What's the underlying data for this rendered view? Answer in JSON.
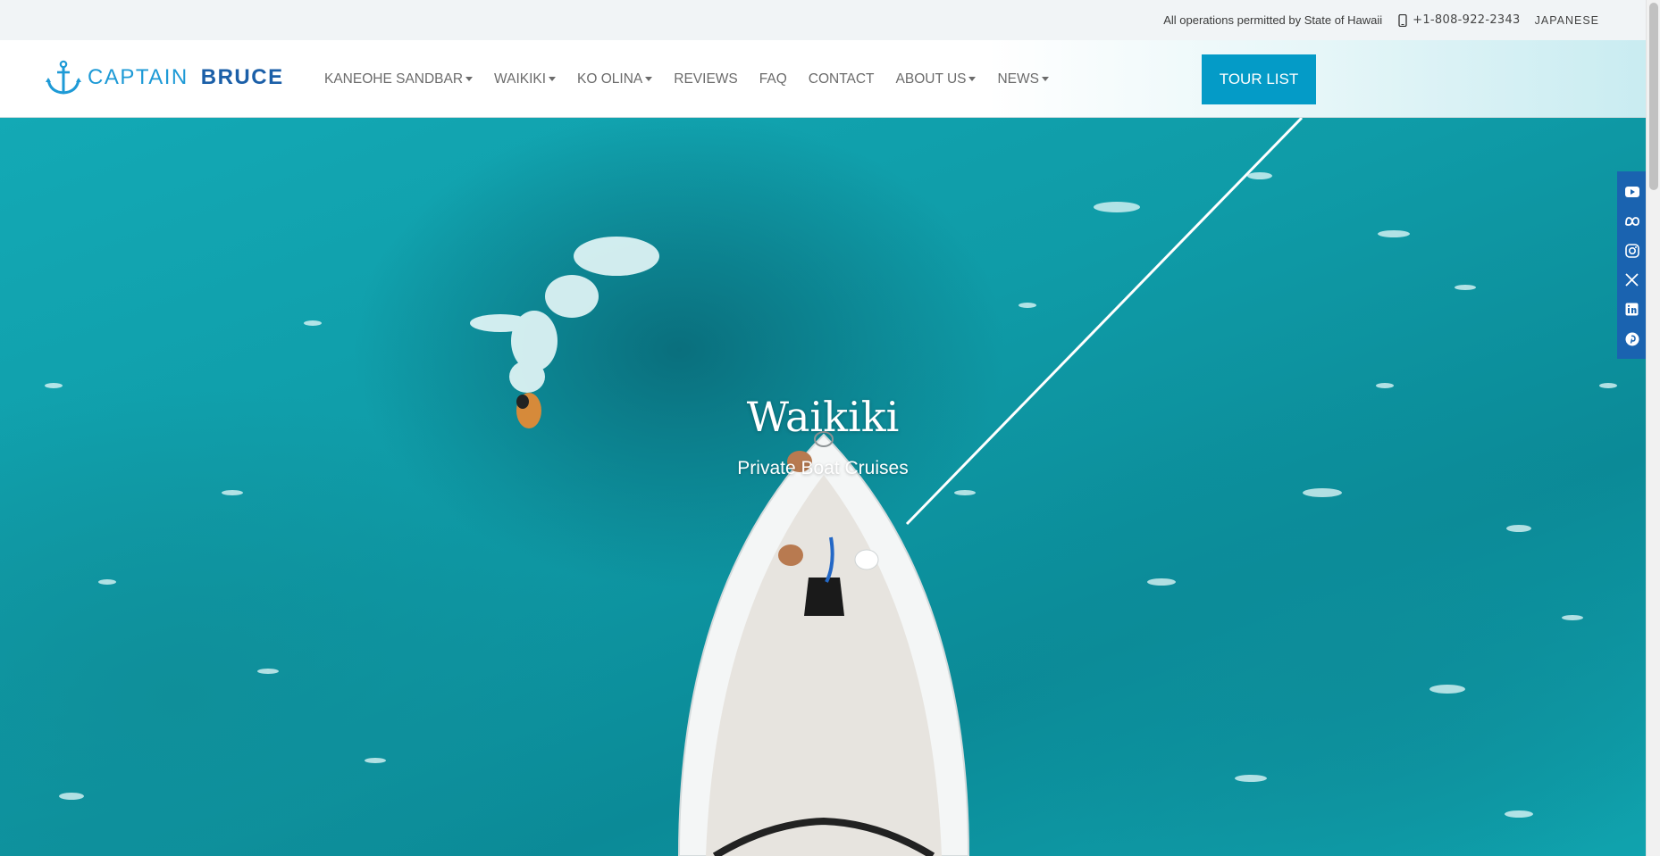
{
  "topbar": {
    "permit_text": "All operations permitted by State of Hawaii",
    "phone": "+1-808-922-2343",
    "language": "JAPANESE"
  },
  "logo": {
    "word1": "CAPTAIN",
    "word2": "BRUCE"
  },
  "nav": {
    "items": [
      {
        "label": "KANEOHE SANDBAR",
        "dropdown": true
      },
      {
        "label": "WAIKIKI",
        "dropdown": true
      },
      {
        "label": "KO OLINA",
        "dropdown": true
      },
      {
        "label": "REVIEWS",
        "dropdown": false
      },
      {
        "label": "FAQ",
        "dropdown": false
      },
      {
        "label": "CONTACT",
        "dropdown": false
      },
      {
        "label": "ABOUT US",
        "dropdown": true
      },
      {
        "label": "NEWS",
        "dropdown": true
      }
    ],
    "tour_button": "TOUR LIST"
  },
  "hero": {
    "title": "Waikiki",
    "subtitle": "Private Boat Cruises"
  },
  "social": [
    "youtube-icon",
    "meta-icon",
    "instagram-icon",
    "x-icon",
    "linkedin-icon",
    "pinterest-icon"
  ],
  "colors": {
    "accent": "#049bc7",
    "brand_dark": "#1b5fa8",
    "brand_light": "#1e9ad6",
    "social_bar": "#1a63b0",
    "ocean": "#0f9ba7"
  }
}
